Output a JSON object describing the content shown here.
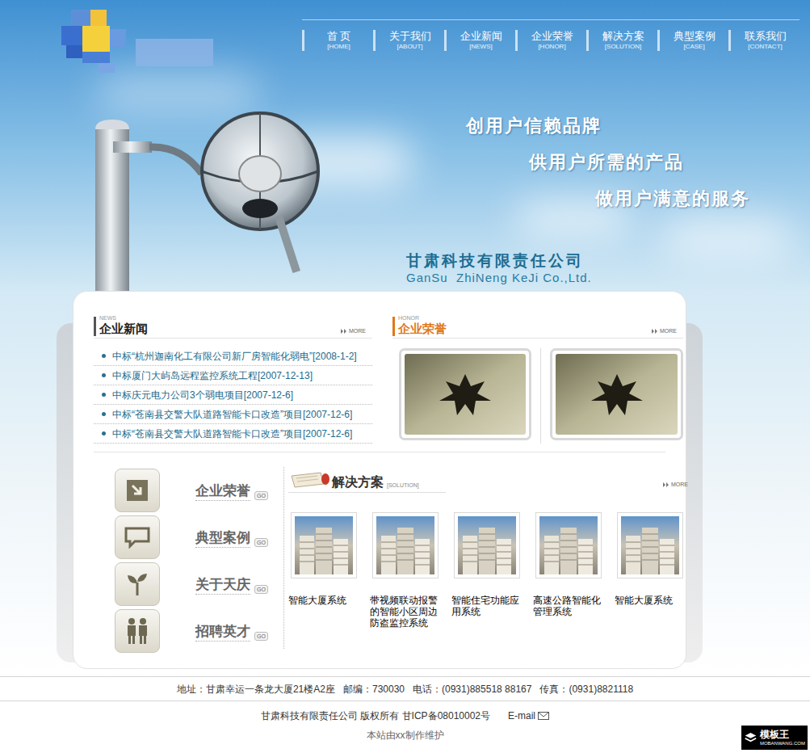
{
  "nav": [
    {
      "label": "首 页",
      "sub": "[HOME]"
    },
    {
      "label": "关于我们",
      "sub": "[ABOUT]"
    },
    {
      "label": "企业新闻",
      "sub": "[NEWS]"
    },
    {
      "label": "企业荣誉",
      "sub": "[HONOR]"
    },
    {
      "label": "解决方案",
      "sub": "[SOLUTION]"
    },
    {
      "label": "典型案例",
      "sub": "[CASE]"
    },
    {
      "label": "联系我们",
      "sub": "[CONTACT]"
    }
  ],
  "slogans": [
    "创用户信赖品牌",
    "供用户所需的产品",
    "做用户满意的服务"
  ],
  "company": {
    "name": "甘肃科技有限责任公司",
    "english": "GanSu  ZhiNeng KeJi Co.,Ltd."
  },
  "news": {
    "tag": "NEWS",
    "title": "企业新闻",
    "more": "MORE",
    "items": [
      "中标“杭州迦南化工有限公司新厂房智能化弱电”[2008-1-2]",
      "中标厦门大屿岛远程监控系统工程[2007-12-13]",
      "中标庆元电力公司3个弱电项目[2007-12-6]",
      "中标“苍南县交警大队道路智能卡口改造”项目[2007-12-6]",
      "中标“苍南县交警大队道路智能卡口改造”项目[2007-12-6]"
    ]
  },
  "honor": {
    "tag": "HONOR",
    "title": "企业荣誉",
    "more": "MORE"
  },
  "links": [
    {
      "label": "企业荣誉",
      "go": "GO"
    },
    {
      "label": "典型案例",
      "go": "GO"
    },
    {
      "label": "关于天庆",
      "go": "GO"
    },
    {
      "label": "招聘英才",
      "go": "GO"
    }
  ],
  "solution": {
    "title": "解决方案",
    "tag": "[SOLUTION]",
    "more": "MORE",
    "items": [
      "智能大厦系统",
      "带视频联动报警的智能小区周边防盗监控系统",
      "智能住宅功能应用系统",
      "高速公路智能化管理系统",
      "智能大厦系统"
    ]
  },
  "footer": {
    "address": [
      "地址：甘肃幸运一条龙大厦21楼A2座",
      "邮编：730030",
      "电话：(0931)885518 88167",
      "传真：(0931)8821118"
    ],
    "copyright": "甘肃科技有限责任公司 版权所有 甘ICP备08010002号",
    "email": "E-mail",
    "maintain": "本站由xx制作维护"
  },
  "watermark": {
    "name": "模板王",
    "site": "MOBANWANG.COM"
  }
}
